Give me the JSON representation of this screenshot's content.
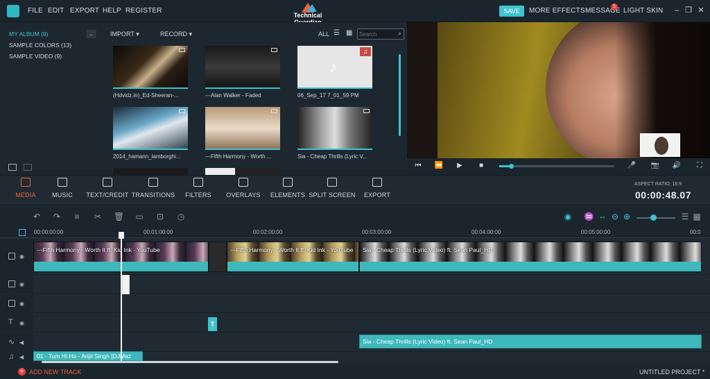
{
  "menu": {
    "items": [
      "FILE",
      "EDIT",
      "EXPORT",
      "HELP",
      "REGISTER"
    ],
    "brand": "Technical Guardian",
    "save": "SAVE",
    "more_effects": "MORE EFFECTS",
    "message": "MESSAGE",
    "message_count": "1",
    "light_skin": "LIGHT SKIN"
  },
  "album": {
    "items": [
      "MY ALBUM (8)",
      "SAMPLE COLORS (13)",
      "SAMPLE VIDEO (9)"
    ]
  },
  "library": {
    "import": "IMPORT",
    "record": "RECORD",
    "all": "ALL",
    "search_placeholder": "Search",
    "items": [
      {
        "label": "(Hdvidz.in)_Ed-Sheeran-...",
        "type": "video"
      },
      {
        "label": "---Alan Walker - Faded",
        "type": "video"
      },
      {
        "label": "06_Sep_17 7_01_59 PM",
        "type": "audio"
      },
      {
        "label": "2014_hamann_lamborghi...",
        "type": "video"
      },
      {
        "label": "---Fifth Harmony - Worth ...",
        "type": "video"
      },
      {
        "label": "Sia - Cheap Thrills (Lyric V...",
        "type": "video"
      }
    ]
  },
  "toolbar": {
    "items": [
      "MEDIA",
      "MUSIC",
      "TEXT/CREDIT",
      "TRANSITIONS",
      "FILTERS",
      "OVERLAYS",
      "ELEMENTS",
      "SPLIT SCREEN",
      "EXPORT"
    ],
    "active": "MEDIA",
    "aspect_ratio": "ASPECT RATIO: 16:9",
    "timecode": "00:00:48.07"
  },
  "ruler": {
    "ticks": [
      "00:00:00:00",
      "00:01:00:00",
      "00:02:00:00",
      "00:03:00:00",
      "00:04:00:00",
      "00:05:00:00",
      "00:0"
    ]
  },
  "timeline": {
    "video_clips": [
      {
        "title": "---Fifth Harmony - Worth It ft. Kid Ink - YouTube"
      },
      {
        "title": "---Fifth Harmony - Worth It ft. Kid Ink - YouTube"
      },
      {
        "title": "Sia - Cheap Thrills (Lyric Video) ft. Sean Paul_HD"
      }
    ],
    "text_marker": "T",
    "audio_clips": [
      {
        "title": "Sia - Cheap Thrills (Lyric Video) ft. Sean Paul_HD"
      },
      {
        "title": "01 - Tum Hi Ho - Arijit Singh [DJMaz"
      }
    ]
  },
  "footer": {
    "add_track": "ADD NEW TRACK",
    "project": "UNTITLED PROJECT *"
  },
  "colors": {
    "accent": "#3fc3cd",
    "active": "#e8663a",
    "background": "#1f2a33"
  }
}
